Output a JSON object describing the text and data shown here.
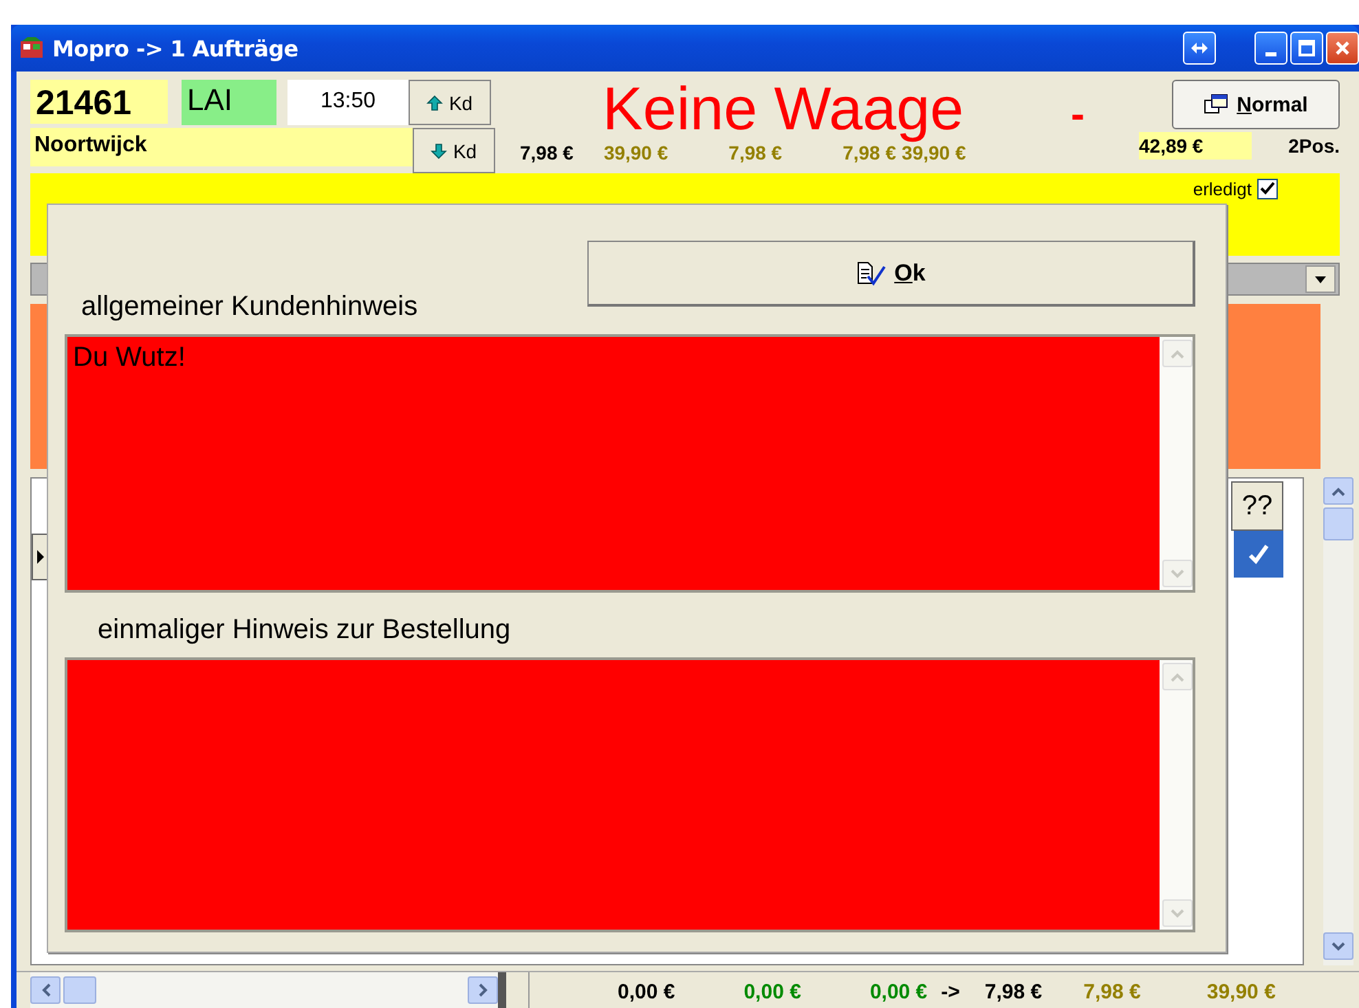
{
  "window": {
    "title": "Mopro -> 1 Aufträge"
  },
  "header": {
    "customer_number": "21461",
    "route": "LAI",
    "time": "13:50",
    "up_button": "Kd",
    "down_button": "Kd",
    "customer_name": "Noortwijck",
    "scale_status": "Keine Waage",
    "scale_dash": "-",
    "mode_button": "Normal",
    "prices": [
      {
        "text": "7,98 €",
        "color": "#000000"
      },
      {
        "text": "39,90 €",
        "color": "#948000"
      },
      {
        "text": "7,98 €",
        "color": "#948000"
      },
      {
        "text": "7,98 €",
        "color": "#948000"
      },
      {
        "text": "39,90 €",
        "color": "#948000"
      }
    ],
    "total": "42,89 €",
    "positions": "2Pos."
  },
  "order_panel": {
    "done_label": "erledigt",
    "done_checked": true
  },
  "grid": {
    "header_cell": "??",
    "row_checked": true
  },
  "footer": {
    "totals": [
      {
        "text": "0,00 €",
        "color": "#000000"
      },
      {
        "text": "0,00 €",
        "color": "#008a00"
      },
      {
        "text": "0,00 €",
        "color": "#008a00"
      },
      {
        "text": "->",
        "color": "#000000"
      },
      {
        "text": "7,98 €",
        "color": "#000000"
      },
      {
        "text": "7,98 €",
        "color": "#948000"
      },
      {
        "text": "39,90 €",
        "color": "#948000"
      }
    ]
  },
  "dialog": {
    "ok_button": "Ok",
    "customer_note": {
      "label": "allgemeiner Kundenhinweis",
      "value": "Du Wutz!"
    },
    "order_note": {
      "label": "einmaliger Hinweis zur Bestellung"
    }
  }
}
